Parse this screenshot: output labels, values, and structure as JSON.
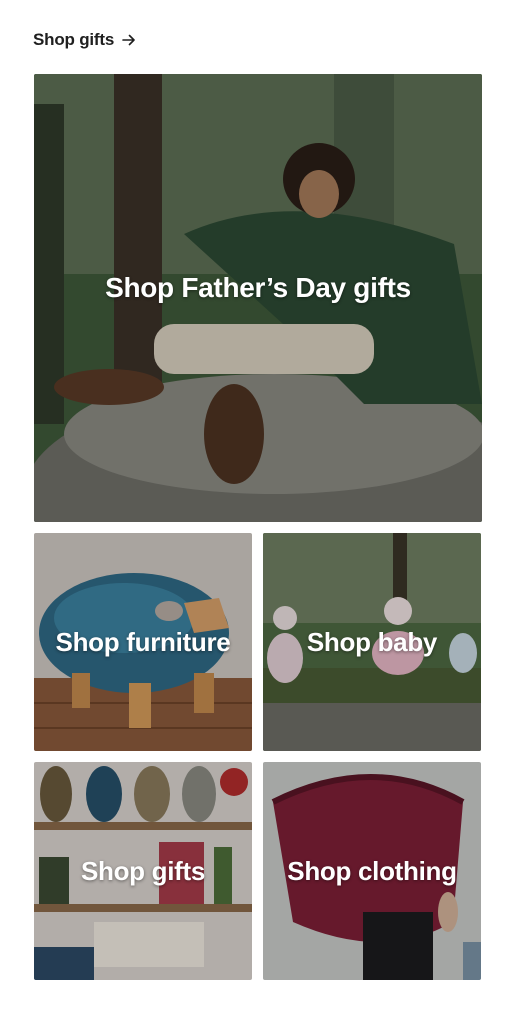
{
  "header": {
    "shop_gifts_link": "Shop gifts",
    "arrow_icon": "arrow-right-icon"
  },
  "hero": {
    "label": "Shop Father’s Day gifts"
  },
  "tiles": [
    {
      "label": "Shop furniture"
    },
    {
      "label": "Shop baby"
    },
    {
      "label": "Shop gifts"
    },
    {
      "label": "Shop clothing"
    }
  ],
  "colors": {
    "text_dark": "#1f1f1f",
    "label_text": "#ffffff"
  }
}
